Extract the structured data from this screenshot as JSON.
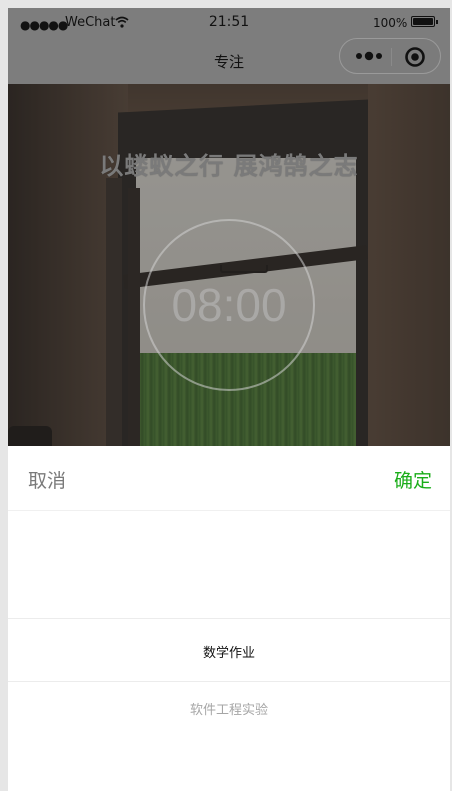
{
  "status_bar": {
    "signal": "●●●●●",
    "carrier": "WeChat",
    "time": "21:51",
    "battery": "100%"
  },
  "nav": {
    "title": "专注",
    "icons": [
      "more-icon",
      "close-circle-icon"
    ]
  },
  "focus": {
    "motto": "以蝼蚁之行 展鸿鹄之志",
    "timer": "08:00"
  },
  "picker": {
    "cancel_label": "取消",
    "confirm_label": "确定",
    "confirm_color": "#1aad19",
    "options": [
      "数学作业",
      "软件工程实验"
    ],
    "selected": "数学作业"
  }
}
